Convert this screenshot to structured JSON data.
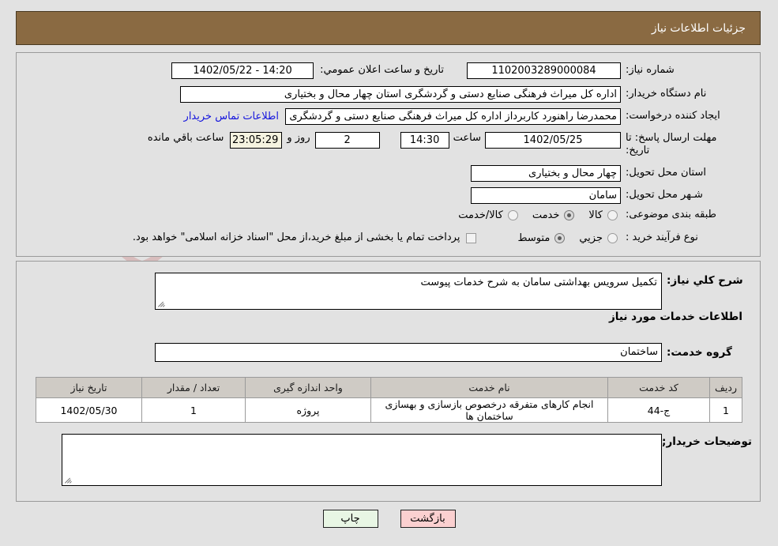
{
  "header": {
    "title": "جزئیات اطلاعات نیاز",
    "bg_color": "#8a6a42",
    "text_color": "#ffffff"
  },
  "watermark": {
    "text": "ArtaTender.net"
  },
  "top_panel": {
    "need_number_label": "شماره نیاز:",
    "need_number_value": "1102003289000084",
    "announce_label": "تاریخ و ساعت اعلان عمومي:",
    "announce_value": "14:20 - 1402/05/22",
    "buyer_org_label": "نام دستگاه خریدار:",
    "buyer_org_value": "اداره کل میراث فرهنگی  صنایع دستی و گردشگری استان چهار محال و بختیاری",
    "creator_label": "ایجاد کننده درخواست:",
    "creator_value": "محمدرضا راهنورد کاربرداز اداره کل میراث فرهنگی  صنایع دستی و گردشگری اس",
    "contact_link": "اطلاعات تماس خریدار",
    "deadline_label_line1": "مهلت ارسال پاسخ: تا",
    "deadline_label_line2": "تاریخ:",
    "deadline_date": "1402/05/25",
    "hour_label": "ساعت",
    "deadline_time": "14:30",
    "days_remaining": "2",
    "days_label": "روز و",
    "time_remaining": "23:05:29",
    "remaining_suffix": "ساعت باقي مانده",
    "province_label": "استان محل تحویل:",
    "province_value": "چهار محال و بختیاری",
    "city_label": "شـهر محل تحویل:",
    "city_value": "سامان",
    "category_label": "طبقه بندی موضوعی:",
    "category_options": [
      {
        "label": "کالا",
        "selected": false
      },
      {
        "label": "خدمت",
        "selected": true
      },
      {
        "label": "کالا/خدمت",
        "selected": false
      }
    ],
    "process_label": "نوع فرآیند خرید :",
    "process_options": [
      {
        "label": "جزیي",
        "selected": false
      },
      {
        "label": "متوسط",
        "selected": true
      }
    ],
    "treasury_checkbox_checked": false,
    "treasury_text": "پرداخت تمام یا بخشی از مبلغ خرید،از محل \"اسناد خزانه اسلامی\" خواهد بود."
  },
  "bottom_panel": {
    "general_desc_label": "شرح کلي نیاز:",
    "general_desc_value": "تکمیل سرویس بهداشتی سامان به شرح خدمات پیوست",
    "services_heading": "اطلاعات خدمات مورد نیاز",
    "service_group_label": "گروه خدمت:",
    "service_group_value": "ساختمان",
    "buyer_notes_label": "توضیحات خریدار;",
    "buyer_notes_value": ""
  },
  "table": {
    "columns": [
      "ردیف",
      "کد خدمت",
      "نام خدمت",
      "واحد اندازه گیری",
      "تعداد / مقدار",
      "تاریخ نیاز"
    ],
    "rows": [
      {
        "row_no": "1",
        "service_code": "ج-44",
        "service_name": "انجام کارهای متفرقه درخصوص بازسازی و بهسازی ساختمان ها",
        "unit": "پروژه",
        "quantity": "1",
        "need_date": "1402/05/30"
      }
    ]
  },
  "buttons": {
    "print_label": "چاپ",
    "back_label": "بازگشت",
    "print_color": "#e8f6e4",
    "back_color": "#fbd0d0"
  }
}
